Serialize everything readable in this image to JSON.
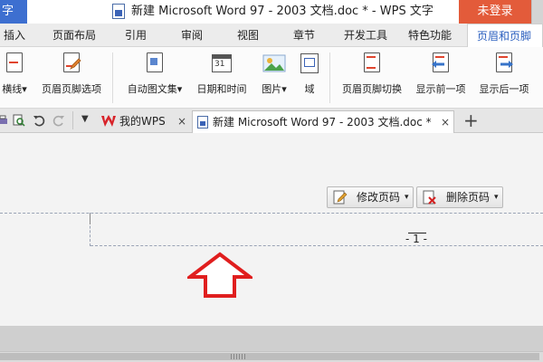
{
  "titlebar": {
    "app_label": "字",
    "title": "新建 Microsoft Word 97 - 2003 文档.doc * - WPS 文字",
    "login": "未登录"
  },
  "tabs": [
    "插入",
    "页面布局",
    "引用",
    "审阅",
    "视图",
    "章节",
    "开发工具",
    "特色功能",
    "页眉和页脚"
  ],
  "active_tab": "页眉和页脚",
  "ribbon": {
    "items": [
      "横线",
      "页眉页脚选项",
      "自动图文集",
      "日期和时间",
      "图片",
      "域",
      "页眉页脚切换",
      "显示前一项",
      "显示后一项"
    ],
    "dropdown_marker": "▾",
    "date_icon_text": "31"
  },
  "doc_tabs": {
    "wps_tab": "我的WPS",
    "doc_tab": "新建 Microsoft Word 97 - 2003 文档.doc *",
    "close": "×",
    "add": "+",
    "menu_arrow": "▼"
  },
  "document": {
    "edit_page_number": "修改页码",
    "delete_page_number": "删除页码",
    "page_number": "- 1 -"
  },
  "colors": {
    "accent_blue": "#3d6fd0",
    "login_red": "#e35b3a",
    "arrow_red": "#e01e1e"
  }
}
